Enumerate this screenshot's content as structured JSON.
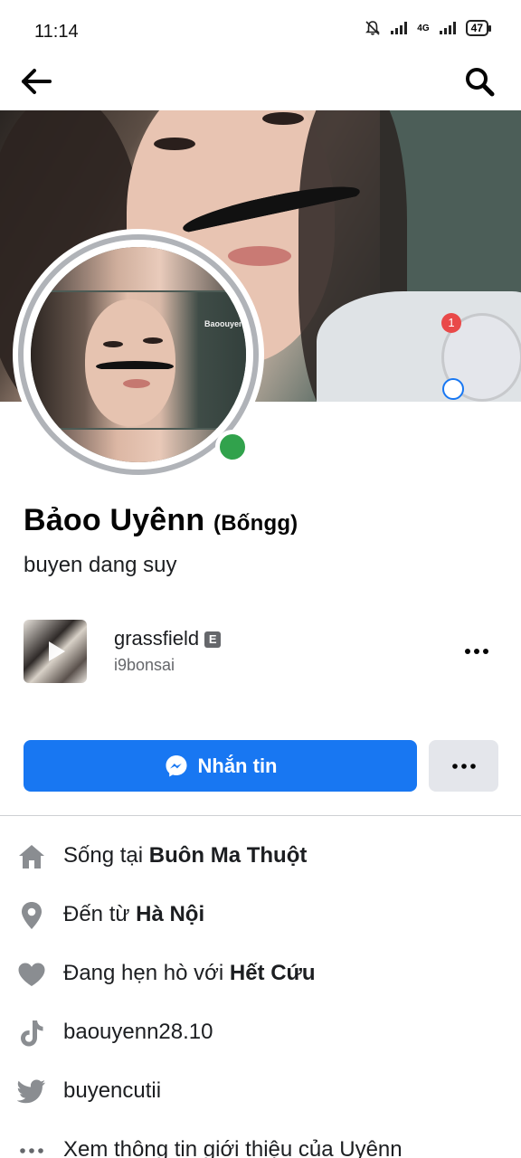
{
  "status_bar": {
    "time": "11:14",
    "network": "4G",
    "battery": "47"
  },
  "nav": {
    "back_icon": "arrow-left-icon",
    "search_icon": "search-icon"
  },
  "cover": {
    "notification_count": "1"
  },
  "avatar": {
    "watermark": "Baoouyenn",
    "online": true,
    "online_color": "#31a24c"
  },
  "profile": {
    "name": "Bảoo  Uyênn",
    "alt_name": "(Bốngg)",
    "bio": "buyen dang suy"
  },
  "featured": {
    "title": "grassfield",
    "badge": "E",
    "subtitle": "i9bonsai"
  },
  "actions": {
    "message_label": "Nhắn tin",
    "accent_color": "#1877f2"
  },
  "info": {
    "lives_prefix": "Sống tại ",
    "lives_value": "Buôn Ma Thuột",
    "from_prefix": "Đến từ ",
    "from_value": "Hà Nội",
    "relationship_prefix": "Đang hẹn hò với ",
    "relationship_value": "Hết Cứu",
    "tiktok": "baouyenn28.10",
    "twitter": "buyencutii",
    "see_about": "Xem thông tin giới thiệu của Uyênn"
  }
}
